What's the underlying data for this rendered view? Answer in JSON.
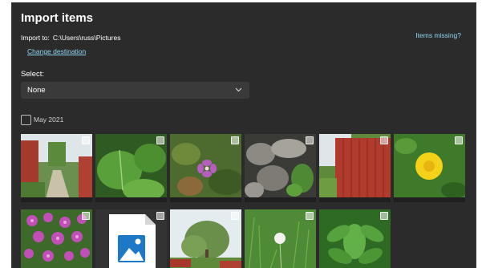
{
  "dialog": {
    "title": "Import items",
    "import_to_label": "Import to:",
    "import_to_path": "C:\\Users\\russ\\Pictures",
    "change_destination": "Change destination",
    "items_missing": "Items missing?"
  },
  "select": {
    "label": "Select:",
    "value": "None"
  },
  "group": {
    "label": "May 2021",
    "checked": false
  },
  "photos": [
    {
      "name": "garden-path-red-fence",
      "checked": false
    },
    {
      "name": "green-leaves",
      "checked": false
    },
    {
      "name": "purple-flower-leaves",
      "checked": false
    },
    {
      "name": "stone-wall-plants",
      "checked": false
    },
    {
      "name": "red-fence-grass",
      "checked": false
    },
    {
      "name": "yellow-dandelion",
      "checked": false
    },
    {
      "name": "pink-flowers",
      "checked": false
    },
    {
      "name": "image-file-placeholder",
      "checked": false
    },
    {
      "name": "tree-red-buildings",
      "checked": false
    },
    {
      "name": "dandelion-seed-grass",
      "checked": false
    },
    {
      "name": "green-plant",
      "checked": false
    }
  ],
  "colors": {
    "background": "#2b2b2b",
    "link": "#8fd6f2",
    "file_icon": "#1e78c8"
  }
}
